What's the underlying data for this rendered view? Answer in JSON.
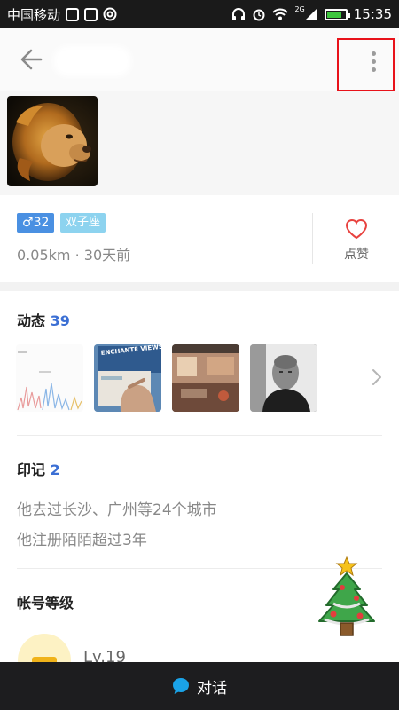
{
  "status_bar": {
    "carrier": "中国移动",
    "network_type": "2G",
    "time": "15:35",
    "battery_level": 0.8
  },
  "app_bar": {
    "back_icon": "arrow-left-icon",
    "more_icon": "more-vertical-icon"
  },
  "profile": {
    "avatar_icon": "lion-avatar",
    "gender_symbol": "♂",
    "age": "32",
    "zodiac": "双子座",
    "distance": "0.05km",
    "separator": "·",
    "last_active": "30天前",
    "like_label": "点赞",
    "like_icon": "heart-icon"
  },
  "feed": {
    "title": "动态",
    "count": "39",
    "thumbnails": [
      {
        "kind": "chart-screenshot"
      },
      {
        "kind": "street-sign-photo",
        "sign_text": "ENCHANTE VIEWS AT BR"
      },
      {
        "kind": "room-photo"
      },
      {
        "kind": "portrait-photo"
      }
    ],
    "chevron_icon": "chevron-right-icon"
  },
  "marks": {
    "title": "印记",
    "count": "2",
    "items": [
      "他去过长沙、广州等24个城市",
      "他注册陌陌超过3年"
    ]
  },
  "account_level": {
    "title": "帐号等级",
    "level": "Lv.19"
  },
  "chat_bar": {
    "label": "对话",
    "icon": "chat-bubble-icon"
  },
  "colors": {
    "accent_blue": "#3b6fd4",
    "gender_badge": "#4a90e2",
    "zodiac_badge": "#8dd3ef",
    "like_heart": "#e8423f",
    "highlight_box": "#e8121a",
    "chat_icon": "#1aa3e8"
  }
}
